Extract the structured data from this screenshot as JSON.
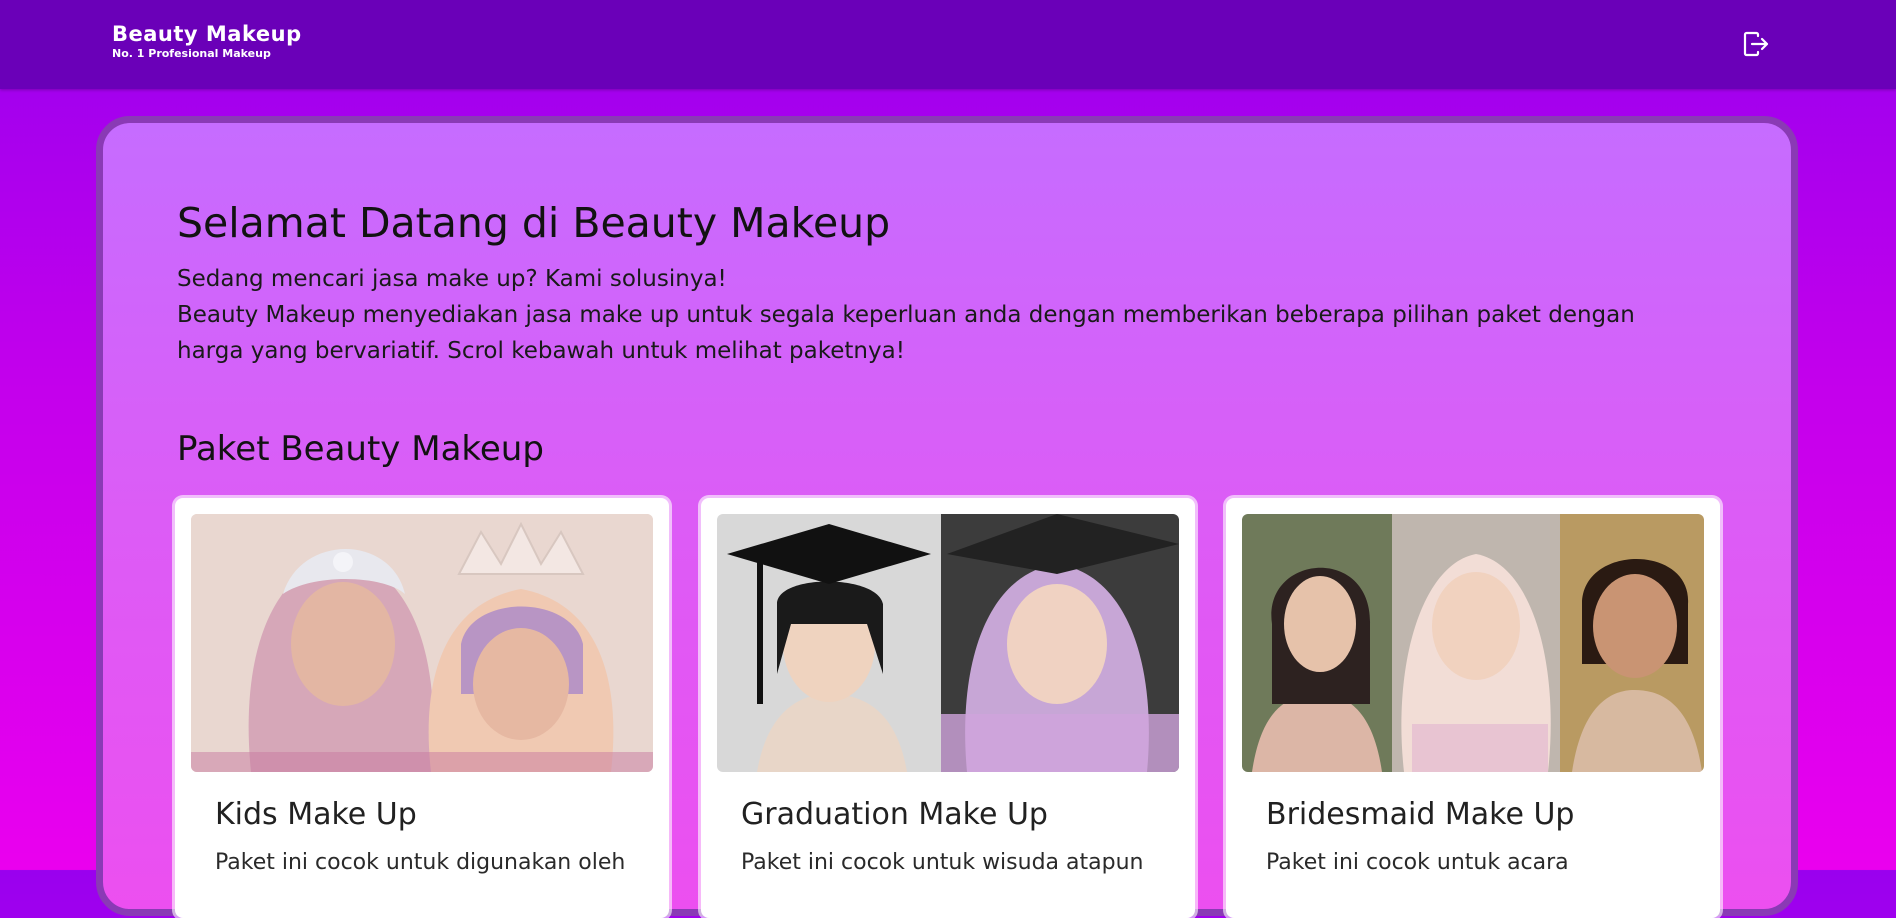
{
  "navbar": {
    "brand_title": "Beauty  Makeup",
    "brand_subtitle": "No. 1 Profesional Makeup",
    "logout_icon": "logout-icon"
  },
  "hero": {
    "title": "Selamat Datang di Beauty Makeup",
    "line1": "Sedang mencari jasa make up? Kami solusinya!",
    "line2": "Beauty Makeup menyediakan jasa make up untuk segala keperluan anda dengan memberikan beberapa pilihan paket dengan harga yang bervariatif. Scrol kebawah untuk melihat paketnya!"
  },
  "packages": {
    "title": "Paket Beauty Makeup",
    "items": [
      {
        "title": "Kids Make Up",
        "description": "Paket ini cocok untuk digunakan oleh"
      },
      {
        "title": "Graduation Make Up",
        "description": "Paket ini cocok untuk wisuda atapun"
      },
      {
        "title": "Bridesmaid Make Up",
        "description": "Paket ini cocok untuk acara"
      }
    ]
  },
  "colors": {
    "navbar": "#6a00b8",
    "panel_border": "#8a3ab5",
    "background_top": "#9a00ee",
    "background_bottom": "#ea00ee"
  }
}
